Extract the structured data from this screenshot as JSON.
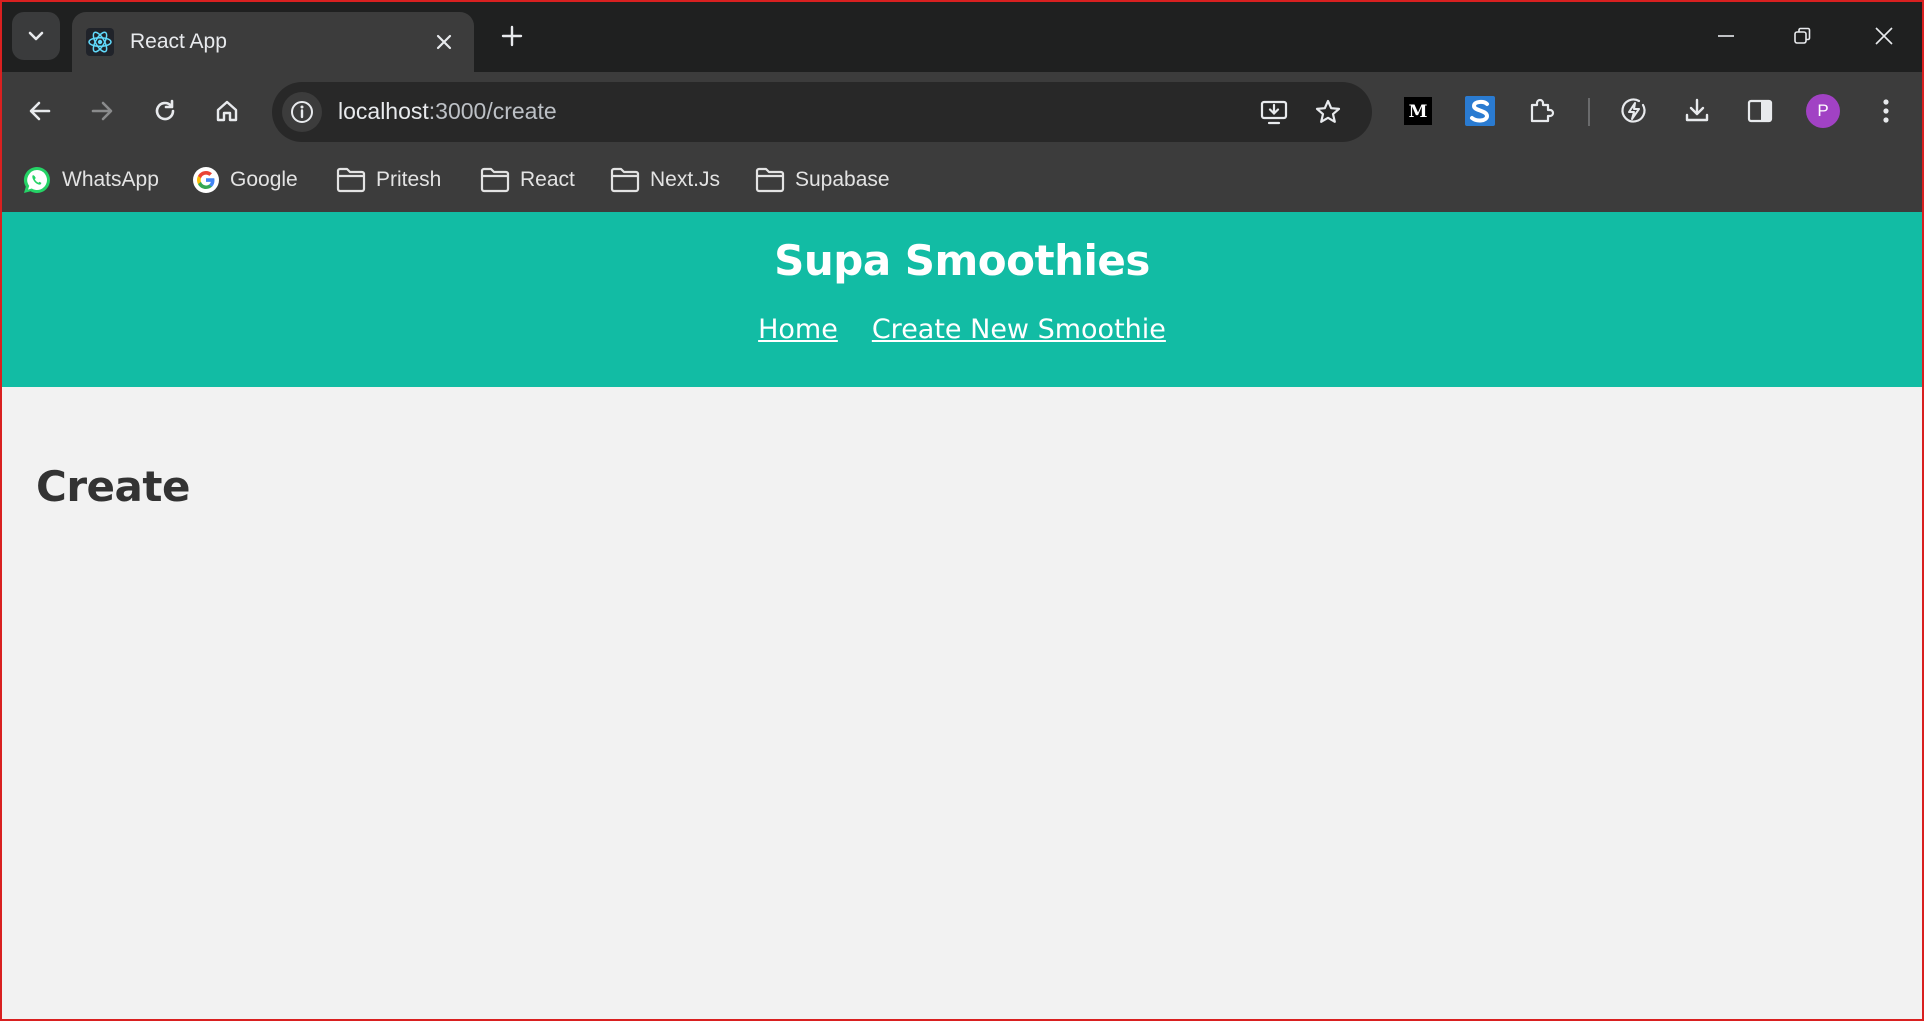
{
  "browser": {
    "tab": {
      "title": "React App"
    },
    "address_bar": {
      "host": "localhost",
      "path": ":3000/create"
    },
    "bookmarks": [
      {
        "label": "WhatsApp",
        "icon": "whatsapp-icon"
      },
      {
        "label": "Google",
        "icon": "google-icon"
      },
      {
        "label": "Pritesh",
        "icon": "folder-icon"
      },
      {
        "label": "React",
        "icon": "folder-icon"
      },
      {
        "label": "Next.Js",
        "icon": "folder-icon"
      },
      {
        "label": "Supabase",
        "icon": "folder-icon"
      }
    ],
    "profile_initial": "P",
    "extensions": [
      "medium-icon",
      "s-extension-icon",
      "puzzle-icon"
    ],
    "colors": {
      "titlebar": "#1f2020",
      "toolbar": "#3c3c3c",
      "omnibox": "#282828",
      "profile": "#a142c4"
    }
  },
  "site": {
    "title": "Supa Smoothies",
    "nav": [
      {
        "label": "Home"
      },
      {
        "label": "Create New Smoothie"
      }
    ],
    "colors": {
      "header": "#12bca4",
      "background": "#f2f2f2",
      "heading": "#333333"
    }
  },
  "page": {
    "heading": "Create"
  }
}
